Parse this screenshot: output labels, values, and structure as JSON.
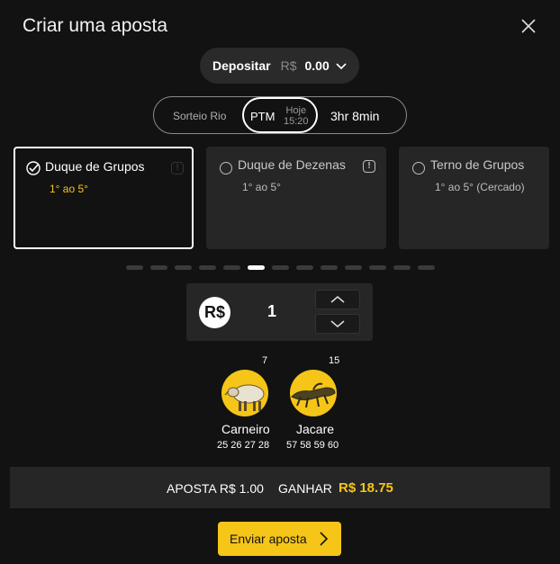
{
  "header": {
    "title": "Criar uma aposta"
  },
  "deposit": {
    "label": "Depositar",
    "currency": "R$",
    "amount": "0.00"
  },
  "draw": {
    "lottery": "Sorteio Rio",
    "selected_code": "PTM",
    "selected_day": "Hoje",
    "selected_time": "15:20",
    "countdown": "3hr 8min"
  },
  "bet_types": [
    {
      "name": "Duque de Grupos",
      "range": "1° ao 5°",
      "selected": true
    },
    {
      "name": "Duque de Dezenas",
      "range": "1° ao 5°",
      "selected": false
    },
    {
      "name": "Terno de Grupos",
      "range": "1° ao 5° (Cercado)",
      "selected": false
    }
  ],
  "pagination": {
    "total": 13,
    "active": 6
  },
  "stake": {
    "currency_symbol": "R$",
    "value": "1"
  },
  "animals": [
    {
      "number": "7",
      "name": "Carneiro",
      "numbers": "25 26 27 28",
      "icon": "sheep-icon"
    },
    {
      "number": "15",
      "name": "Jacare",
      "numbers": "57 58 59 60",
      "icon": "alligator-icon"
    }
  ],
  "summary": {
    "bet_label": "APOSTA R$ 1.00",
    "win_label": "GANHAR",
    "win_value": "R$ 18.75"
  },
  "submit": {
    "label": "Enviar aposta"
  },
  "colors": {
    "accent": "#f5c518",
    "background": "#121212",
    "panel": "#262626"
  }
}
